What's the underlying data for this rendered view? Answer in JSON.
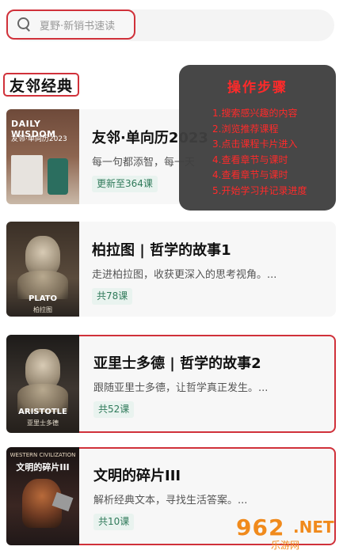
{
  "search": {
    "placeholder": "夏野·新销书速读"
  },
  "section": {
    "title": "友邻经典"
  },
  "cards": [
    {
      "title": "友邻·单向历2023",
      "desc": "每一句都添智，每一天",
      "badge": "更新至364课",
      "cover_lines": [
        "DAILY WISDOM",
        "友邻·单向历2023"
      ]
    },
    {
      "title": "柏拉图 | 哲学的故事1",
      "desc": "走进柏拉图，收获更深入的思考视角。...",
      "badge": "共78课",
      "cover_lines": [
        "PLATO",
        "柏拉图"
      ]
    },
    {
      "title": "亚里士多德 | 哲学的故事2",
      "desc": "跟随亚里士多德，让哲学真正发生。...",
      "badge": "共52课",
      "cover_lines": [
        "ARISTOTLE",
        "亚里士多德"
      ]
    },
    {
      "title": "文明的碎片III",
      "desc": "解析经典文本，寻找生活答案。...",
      "badge": "共10课",
      "cover_lines": [
        "WESTERN CIVILIZATION",
        "文明的碎片III"
      ]
    }
  ],
  "overlay": {
    "title": "操作步骤",
    "steps": [
      "1.搜索感兴趣的内容",
      "2.浏览推荐课程",
      "3.点击课程卡片进入",
      "4.查看章节与课时",
      "4.查看章节与课时",
      "5.开始学习并记录进度"
    ]
  },
  "watermark": {
    "logo": "962",
    "net": ".NET",
    "site": "乐游网"
  },
  "colors": {
    "highlight": "#d0313a",
    "overlay_text": "#ff2a2a",
    "badge_text": "#2f7a5a",
    "watermark": "#f08a1c"
  }
}
